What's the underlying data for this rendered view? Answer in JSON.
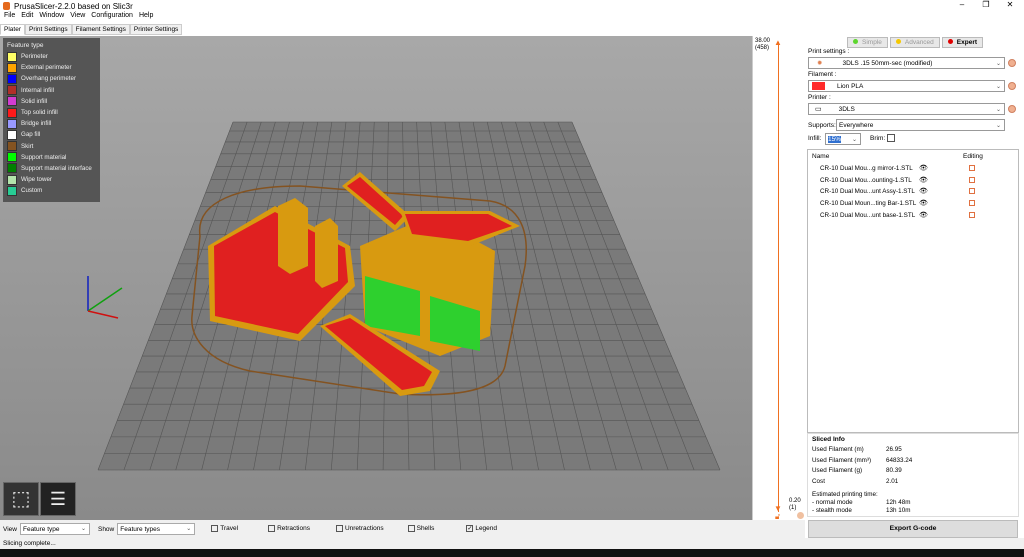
{
  "window": {
    "title": "PrusaSlicer-2.2.0 based on Slic3r"
  },
  "menu": [
    "File",
    "Edit",
    "Window",
    "View",
    "Configuration",
    "Help"
  ],
  "tabs": [
    "Plater",
    "Print Settings",
    "Filament Settings",
    "Printer Settings"
  ],
  "legend": {
    "title": "Feature type",
    "items": [
      {
        "label": "Perimeter",
        "color": "#ffff66"
      },
      {
        "label": "External perimeter",
        "color": "#ffa500"
      },
      {
        "label": "Overhang perimeter",
        "color": "#0000ff"
      },
      {
        "label": "Internal infill",
        "color": "#b03029"
      },
      {
        "label": "Solid infill",
        "color": "#d23cd2"
      },
      {
        "label": "Top solid infill",
        "color": "#ff1a1a"
      },
      {
        "label": "Bridge infill",
        "color": "#9999ff"
      },
      {
        "label": "Gap fill",
        "color": "#ffffff"
      },
      {
        "label": "Skirt",
        "color": "#845321"
      },
      {
        "label": "Support material",
        "color": "#00ff00"
      },
      {
        "label": "Support material interface",
        "color": "#008000"
      },
      {
        "label": "Wipe tower",
        "color": "#b3e3ab"
      },
      {
        "label": "Custom",
        "color": "#28cc94"
      }
    ]
  },
  "layer_slider": {
    "top_value": "38.00",
    "top_layer": "(458)",
    "bottom_value": "0.20",
    "bottom_layer": "(1)",
    "color": "#f07020"
  },
  "modes": [
    {
      "label": "Simple",
      "color": "#5cd62d"
    },
    {
      "label": "Advanced",
      "color": "#f5c800"
    },
    {
      "label": "Expert",
      "color": "#e00000"
    }
  ],
  "print_settings": {
    "label": "Print settings :",
    "value": "3DLS .15 50mm-sec (modified)"
  },
  "filament": {
    "label": "Filament :",
    "value": "Lion PLA",
    "color": "#ff2a2a"
  },
  "printer": {
    "label": "Printer :",
    "value": "3DLS"
  },
  "supports": {
    "label": "Supports:",
    "value": "Everywhere"
  },
  "infill": {
    "label": "Infill:",
    "value": "15%"
  },
  "brim": {
    "label": "Brim:",
    "checked": false
  },
  "objects": {
    "col_name": "Name",
    "col_editing": "Editing",
    "items": [
      "CR-10 Dual Mou...g mirror-1.STL",
      "CR-10 Dual Mou...ounting-1.STL",
      "CR-10 Dual Mou...unt Assy-1.STL",
      "CR-10 Dual Moun...ting Bar-1.STL",
      "CR-10 Dual Mou...unt base-1.STL"
    ]
  },
  "sliced_info": {
    "title": "Sliced Info",
    "rows": [
      {
        "label": "Used Filament (m)",
        "value": "26.95"
      },
      {
        "label": "Used Filament (mm³)",
        "value": "64833.24"
      },
      {
        "label": "Used Filament (g)",
        "value": "80.39"
      },
      {
        "label": "Cost",
        "value": "2.01"
      }
    ],
    "time_label": "Estimated printing time:",
    "normal_label": "- normal mode",
    "normal_value": "12h 48m",
    "stealth_label": "- stealth mode",
    "stealth_value": "13h 10m"
  },
  "export_label": "Export G-code",
  "bottom": {
    "view_label": "View",
    "view_value": "Feature type",
    "show_label": "Show",
    "show_value": "Feature types",
    "checks": [
      {
        "label": "Travel",
        "checked": false
      },
      {
        "label": "Retractions",
        "checked": false
      },
      {
        "label": "Unretractions",
        "checked": false
      },
      {
        "label": "Shells",
        "checked": false
      },
      {
        "label": "Legend",
        "checked": true
      }
    ]
  },
  "status": "Slicing complete..."
}
